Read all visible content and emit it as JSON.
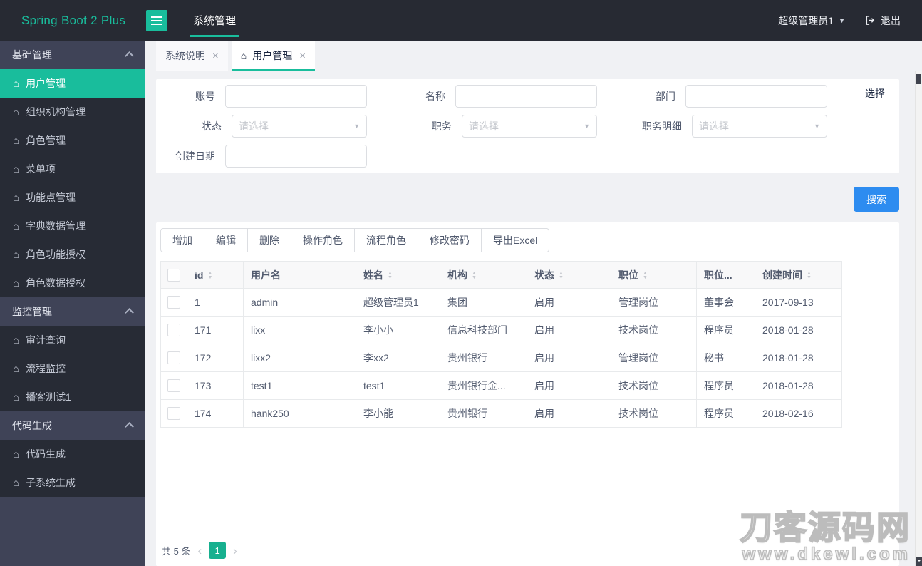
{
  "colors": {
    "accent": "#19bd9c",
    "primary": "#2d8cf0",
    "header_bg": "#272a33",
    "sidebar_bg": "#3f4357",
    "submenu_bg": "#272b35",
    "page_active": "#17b08f"
  },
  "icons": {
    "home": "⌂",
    "close": "×",
    "chevron_down": "▼",
    "prev": "‹",
    "next": "›",
    "sort_asc": "▲",
    "sort_desc": "▼"
  },
  "header": {
    "logo": "Spring Boot 2 Plus",
    "nav": [
      {
        "label": "系统管理",
        "active": true
      }
    ],
    "user": "超级管理员1",
    "logout_label": "退出"
  },
  "sidebar": {
    "sections": [
      {
        "label": "基础管理",
        "expanded": true,
        "items": [
          {
            "label": "用户管理",
            "active": true
          },
          {
            "label": "组织机构管理"
          },
          {
            "label": "角色管理"
          },
          {
            "label": "菜单项"
          },
          {
            "label": "功能点管理"
          },
          {
            "label": "字典数据管理"
          },
          {
            "label": "角色功能授权"
          },
          {
            "label": "角色数据授权"
          }
        ]
      },
      {
        "label": "监控管理",
        "expanded": true,
        "items": [
          {
            "label": "审计查询"
          },
          {
            "label": "流程监控"
          },
          {
            "label": "播客测试1"
          }
        ]
      },
      {
        "label": "代码生成",
        "expanded": true,
        "items": [
          {
            "label": "代码生成"
          },
          {
            "label": "子系统生成"
          }
        ]
      }
    ]
  },
  "tabs": [
    {
      "label": "系统说明",
      "active": false
    },
    {
      "label": "用户管理",
      "active": true
    }
  ],
  "search_form": {
    "fields": [
      {
        "label": "账号",
        "type": "input",
        "value": ""
      },
      {
        "label": "名称",
        "type": "input",
        "value": ""
      },
      {
        "label": "部门",
        "type": "input",
        "value": ""
      },
      {
        "label": "状态",
        "type": "select",
        "placeholder": "请选择"
      },
      {
        "label": "职务",
        "type": "select",
        "placeholder": "请选择"
      },
      {
        "label": "职务明细",
        "type": "select",
        "placeholder": "请选择"
      },
      {
        "label": "创建日期",
        "type": "input",
        "value": ""
      }
    ],
    "choose_link": "选择",
    "search_button": "搜索"
  },
  "toolbar": {
    "buttons": [
      "增加",
      "编辑",
      "删除",
      "操作角色",
      "流程角色",
      "修改密码",
      "导出Excel"
    ]
  },
  "table": {
    "columns": [
      {
        "label": "id",
        "sortable": true
      },
      {
        "label": "用户名",
        "sortable": false
      },
      {
        "label": "姓名",
        "sortable": true
      },
      {
        "label": "机构",
        "sortable": true
      },
      {
        "label": "状态",
        "sortable": true
      },
      {
        "label": "职位",
        "sortable": true
      },
      {
        "label": "职位...",
        "sortable": false
      },
      {
        "label": "创建时间",
        "sortable": true
      }
    ],
    "rows": [
      [
        "1",
        "admin",
        "超级管理员1",
        "集团",
        "启用",
        "管理岗位",
        "董事会",
        "2017-09-13"
      ],
      [
        "171",
        "lixx",
        "李小小",
        "信息科技部门",
        "启用",
        "技术岗位",
        "程序员",
        "2018-01-28"
      ],
      [
        "172",
        "lixx2",
        "李xx2",
        "贵州银行",
        "启用",
        "管理岗位",
        "秘书",
        "2018-01-28"
      ],
      [
        "173",
        "test1",
        "test1",
        "贵州银行金...",
        "启用",
        "技术岗位",
        "程序员",
        "2018-01-28"
      ],
      [
        "174",
        "hank250",
        "李小能",
        "贵州银行",
        "启用",
        "技术岗位",
        "程序员",
        "2018-02-16"
      ]
    ]
  },
  "pagination": {
    "total_text": "共 5 条",
    "pages": [
      "1"
    ],
    "current": "1"
  },
  "watermark": {
    "line1": "刀客源码网",
    "line2": "www.dkewl.com"
  }
}
